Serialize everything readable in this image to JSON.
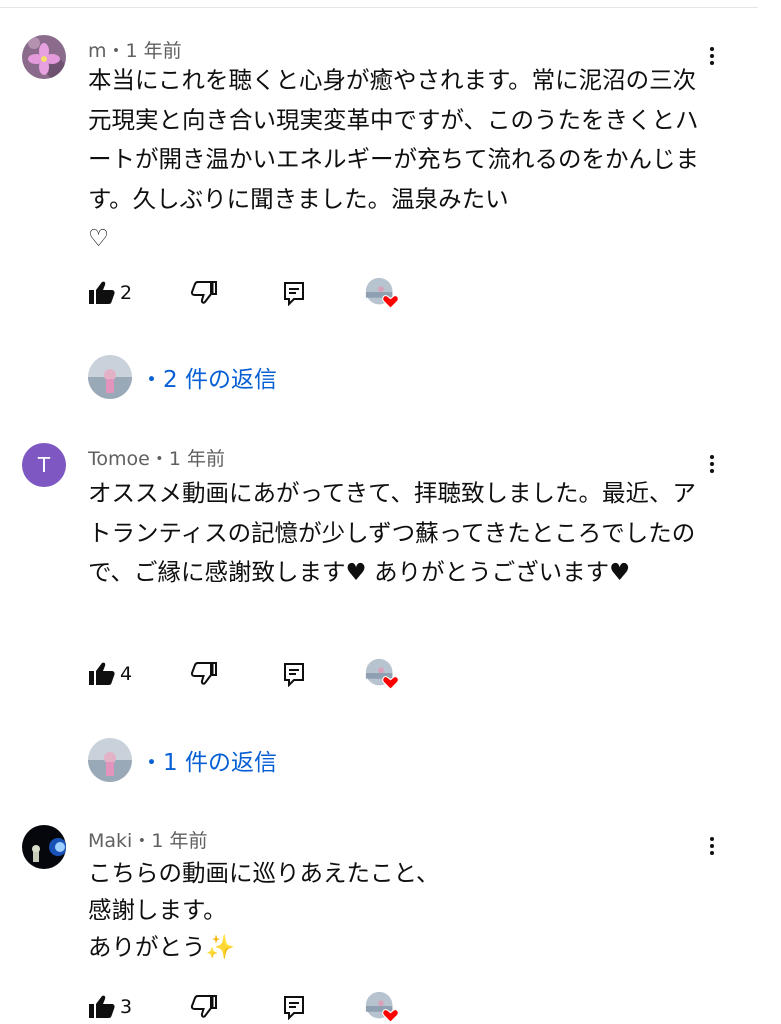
{
  "comments": [
    {
      "author": "m",
      "time": "・1 年前",
      "text": "本当にこれを聴くと心身が癒やされます。常に泥沼の三次元現実と向き合い現実変革中ですが、このうたをきくとハートが開き温かいエネルギーが充ちて流れるのをかんじます。久しぶりに聞きました。温泉みたい\n♡",
      "likes": "2",
      "replies": "・2 件の返信",
      "avatar_icon": "flower-avatar"
    },
    {
      "author": "Tomoe",
      "time": "・1 年前",
      "avatar_letter": "T",
      "text": "オススメ動画にあがってきて、拝聴致しました。最近、アトランティスの記憶が少しずつ蘇ってきたところでしたので、ご縁に感謝致します♥ ありがとうございます♥",
      "likes": "4",
      "replies": "・1 件の返信"
    },
    {
      "author": "Maki",
      "time": "・1 年前",
      "text": "こちらの動画に巡りあえたこと、\n感謝します。\nありがとう✨",
      "likes": "3",
      "avatar_icon": "night-avatar"
    }
  ],
  "icons": {
    "like": "thumb-up-icon",
    "dislike": "thumb-down-icon",
    "reply": "reply-icon",
    "more": "more-vert-icon",
    "creator_heart": "creator-heart-icon"
  },
  "colors": {
    "link": "#065fd4",
    "heart": "#ff0000",
    "letter_avatar": "#7e57c2"
  }
}
